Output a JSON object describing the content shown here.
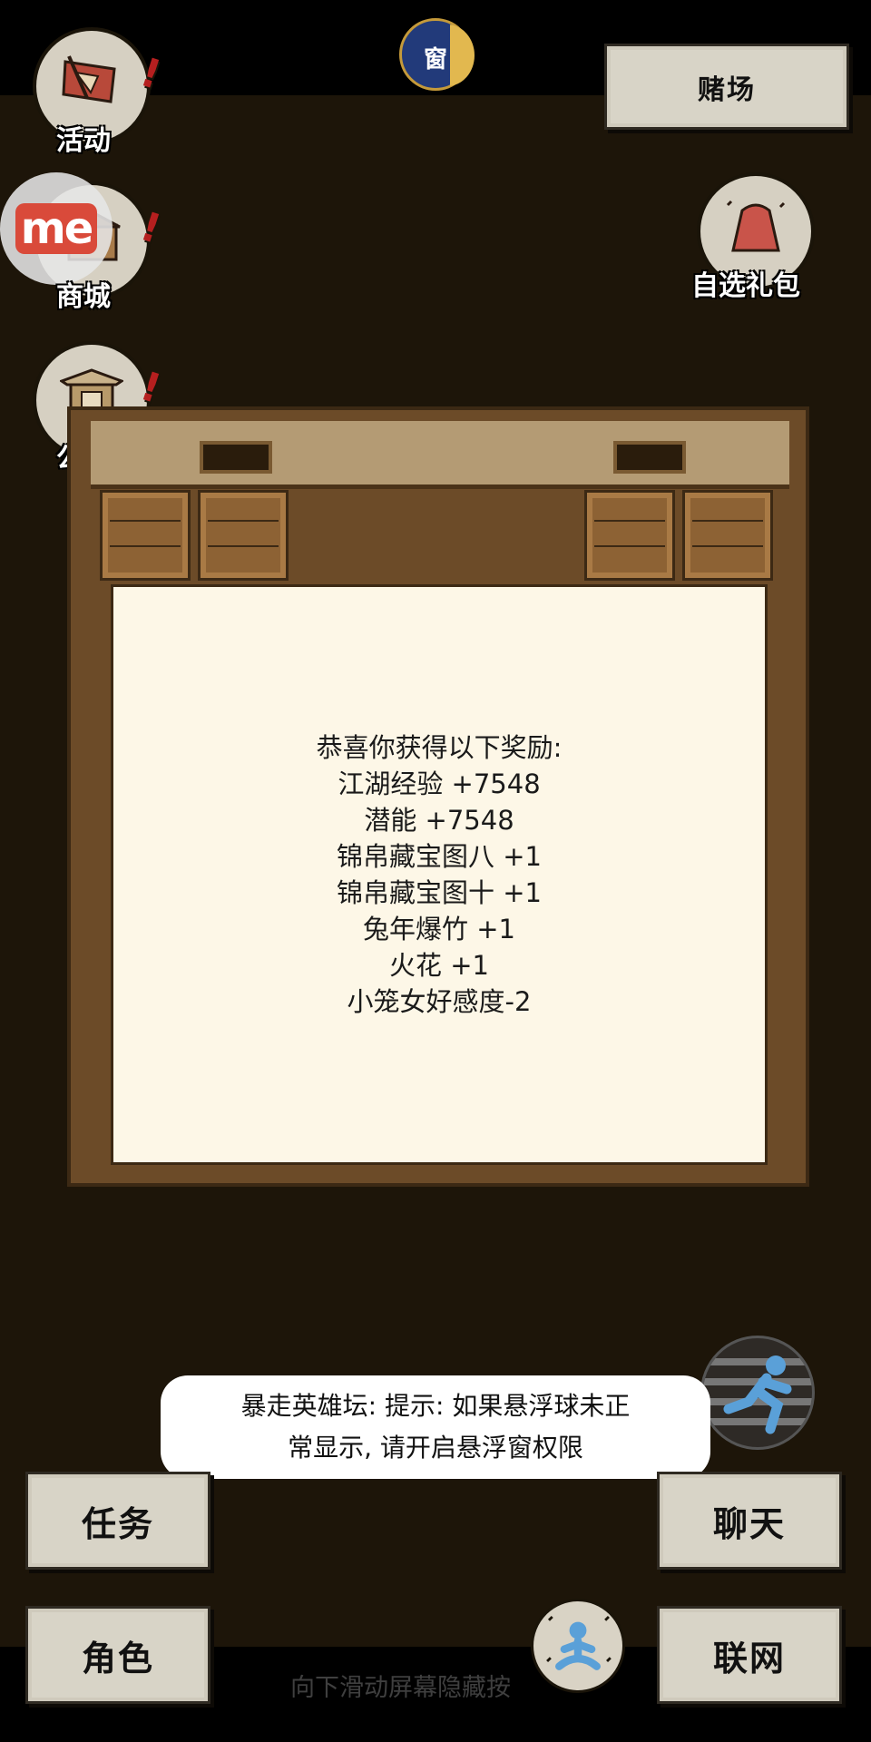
{
  "top": {
    "casino_label": "赌场",
    "moon_glyph": "窗"
  },
  "side_menu": {
    "activity_label": "活动",
    "shop_label": "商城",
    "notice_label": "公告",
    "gift_pack_label": "自选礼包",
    "me_logo_text": "me"
  },
  "reward_panel": {
    "title": "恭喜你获得以下奖励:",
    "items": [
      "江湖经验 +7548",
      "潜能 +7548",
      "锦帛藏宝图八 +1",
      "锦帛藏宝图十 +1",
      "兔年爆竹 +1",
      "火花 +1",
      "小笼女好感度-2"
    ]
  },
  "toast": {
    "line1": "暴走英雄坛: 提示: 如果悬浮球未正",
    "line2": "常显示, 请开启悬浮窗权限"
  },
  "bottom": {
    "task_label": "任务",
    "chat_label": "聊天",
    "role_label": "角色",
    "net_label": "联网",
    "hint_text": "向下滑动屏幕隐藏按"
  },
  "colors": {
    "scene_bg": "#1d1509",
    "button_paper": "#d8d4c7",
    "panel_bg": "#fdf7e7",
    "badge_red": "#b51f1f"
  }
}
